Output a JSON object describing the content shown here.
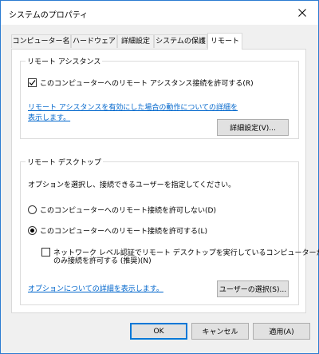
{
  "window": {
    "title": "システムのプロパティ"
  },
  "tabs": [
    {
      "label": "コンピューター名"
    },
    {
      "label": "ハードウェア"
    },
    {
      "label": "詳細設定"
    },
    {
      "label": "システムの保護"
    },
    {
      "label": "リモート"
    }
  ],
  "active_tab": "リモート",
  "remote_assistance": {
    "legend": "リモート アシスタンス",
    "allow_label": "このコンピューターへのリモート アシスタンス接続を許可する(R)",
    "allow_checked": true,
    "link_line1": "リモート アシスタンスを有効にした場合の動作についての詳細を",
    "link_line2": "表示します。",
    "advanced_button": "詳細設定(V)..."
  },
  "remote_desktop": {
    "legend": "リモート デスクトップ",
    "instruction": "オプションを選択し、接続できるユーザーを指定してください。",
    "option_deny": "このコンピューターへのリモート接続を許可しない(D)",
    "option_allow": "このコンピューターへのリモート接続を許可する(L)",
    "selected_option": "allow",
    "nla_line1": "ネットワーク レベル認証でリモート デスクトップを実行しているコンピューターから",
    "nla_line2": "のみ接続を許可する (推奨)(N)",
    "nla_checked": false,
    "help_link": "オプションについての詳細を表示します。",
    "select_users_button": "ユーザーの選択(S)..."
  },
  "footer": {
    "ok": "OK",
    "cancel": "キャンセル",
    "apply": "適用(A)"
  },
  "colors": {
    "accent": "#0078d7",
    "link": "#0066cc",
    "window_border": "#2b7bd1"
  }
}
